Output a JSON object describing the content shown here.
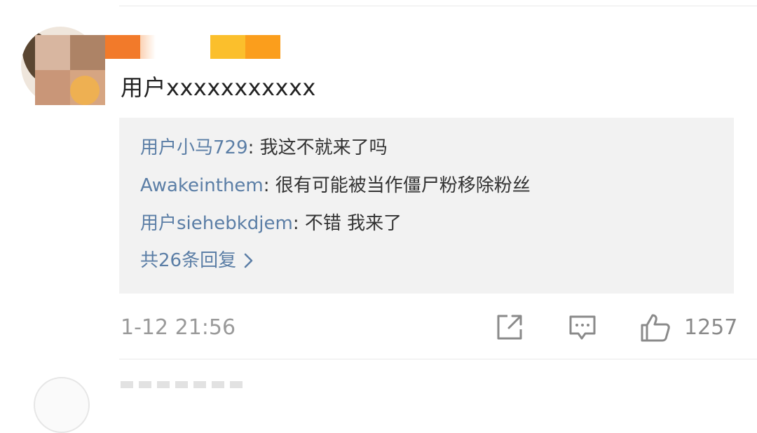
{
  "comment": {
    "text": "用户xxxxxxxxxxx",
    "timestamp": "1-12 21:56",
    "like_count": "1257"
  },
  "replies": [
    {
      "author": "用户小马729",
      "separator": ": ",
      "text": "我这不就来了吗"
    },
    {
      "author": "Awakeinthem",
      "separator": ": ",
      "text": "很有可能被当作僵尸粉移除粉丝"
    },
    {
      "author": "用户siehebkdjem",
      "separator": ": ",
      "text": "不错 我来了"
    }
  ],
  "more_replies": "共26条回复",
  "colors": {
    "link": "#5b7ea6",
    "text": "#333333",
    "muted": "#9a9a9a",
    "reply_bg": "#f2f2f2"
  },
  "icons": [
    "share-icon",
    "comment-icon",
    "like-icon",
    "chevron-right-icon"
  ]
}
